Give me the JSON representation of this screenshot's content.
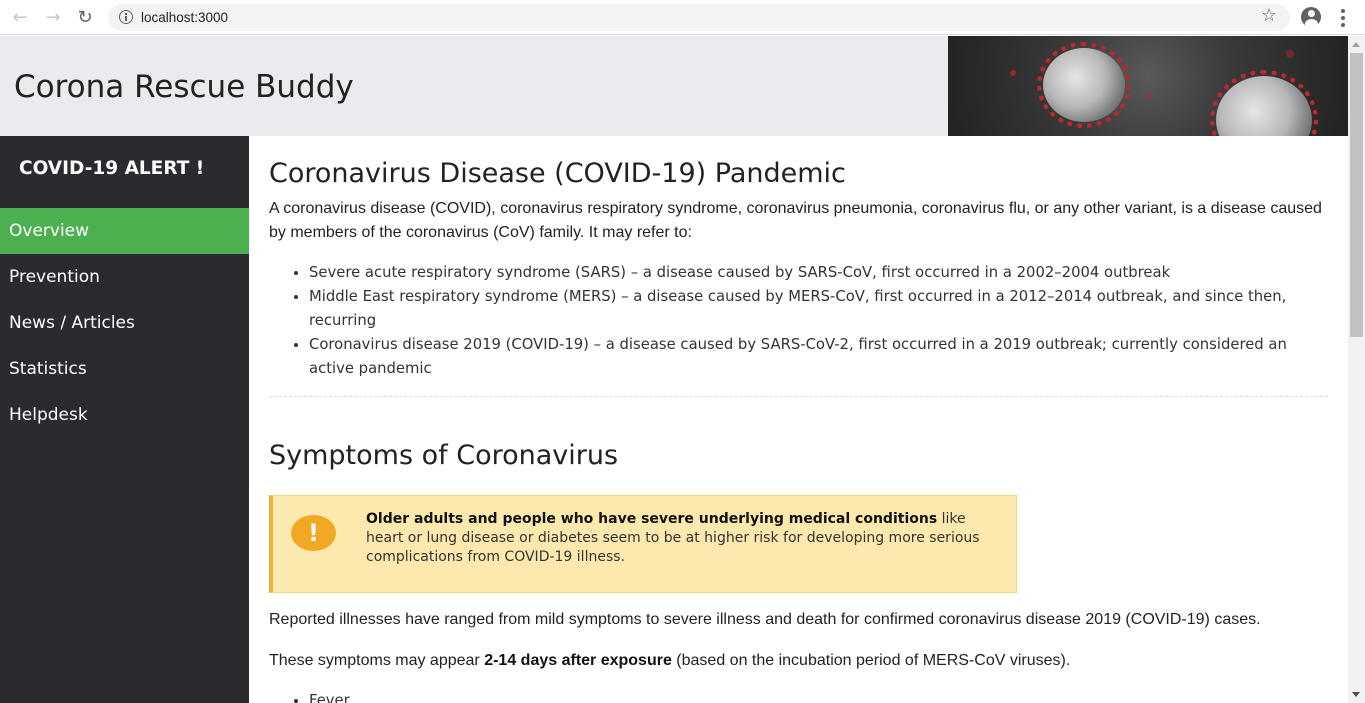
{
  "browser": {
    "url": "localhost:3000",
    "icons": [
      "back-arrow-icon",
      "forward-arrow-icon",
      "reload-icon",
      "info-icon",
      "star-icon",
      "account-icon",
      "kebab-menu-icon"
    ]
  },
  "header": {
    "title": "Corona Rescue Buddy"
  },
  "sidebar": {
    "alert_title": "COVID-19 ALERT !",
    "active_color": "#4caf50",
    "items": [
      {
        "label": "Overview",
        "active": true
      },
      {
        "label": "Prevention",
        "active": false
      },
      {
        "label": "News / Articles",
        "active": false
      },
      {
        "label": "Statistics",
        "active": false
      },
      {
        "label": "Helpdesk",
        "active": false
      }
    ]
  },
  "main": {
    "heading1": "Coronavirus Disease (COVID-19) Pandemic",
    "intro": "A coronavirus disease (COVID), coronavirus respiratory syndrome, coronavirus pneumonia, coronavirus flu, or any other variant, is a disease caused by members of the coronavirus (CoV) family. It may refer to:",
    "bullets": [
      "Severe acute respiratory syndrome (SARS) – a disease caused by SARS-CoV, first occurred in a 2002–2004 outbreak",
      "Middle East respiratory syndrome (MERS) – a disease caused by MERS-CoV, first occurred in a 2012–2014 outbreak, and since then, recurring",
      "Coronavirus disease 2019 (COVID-19) – a disease caused by SARS-CoV-2, first occurred in a 2019 outbreak; currently considered an active pandemic"
    ],
    "heading2": "Symptoms of Coronavirus",
    "callout": {
      "bold": "Older adults and people who have severe underlying medical conditions",
      "text": " like heart or lung disease or diabetes seem to be at higher risk for developing more serious complications from COVID-19 illness.",
      "icon": "exclamation-icon"
    },
    "para1": "Reported illnesses have ranged from mild symptoms to severe illness and death for confirmed coronavirus disease 2019 (COVID-19) cases.",
    "para2_prefix": "These symptoms may appear ",
    "para2_bold": "2-14 days after exposure",
    "para2_suffix": " (based on the incubation period of MERS-CoV viruses).",
    "symptoms": [
      "Fever"
    ]
  }
}
